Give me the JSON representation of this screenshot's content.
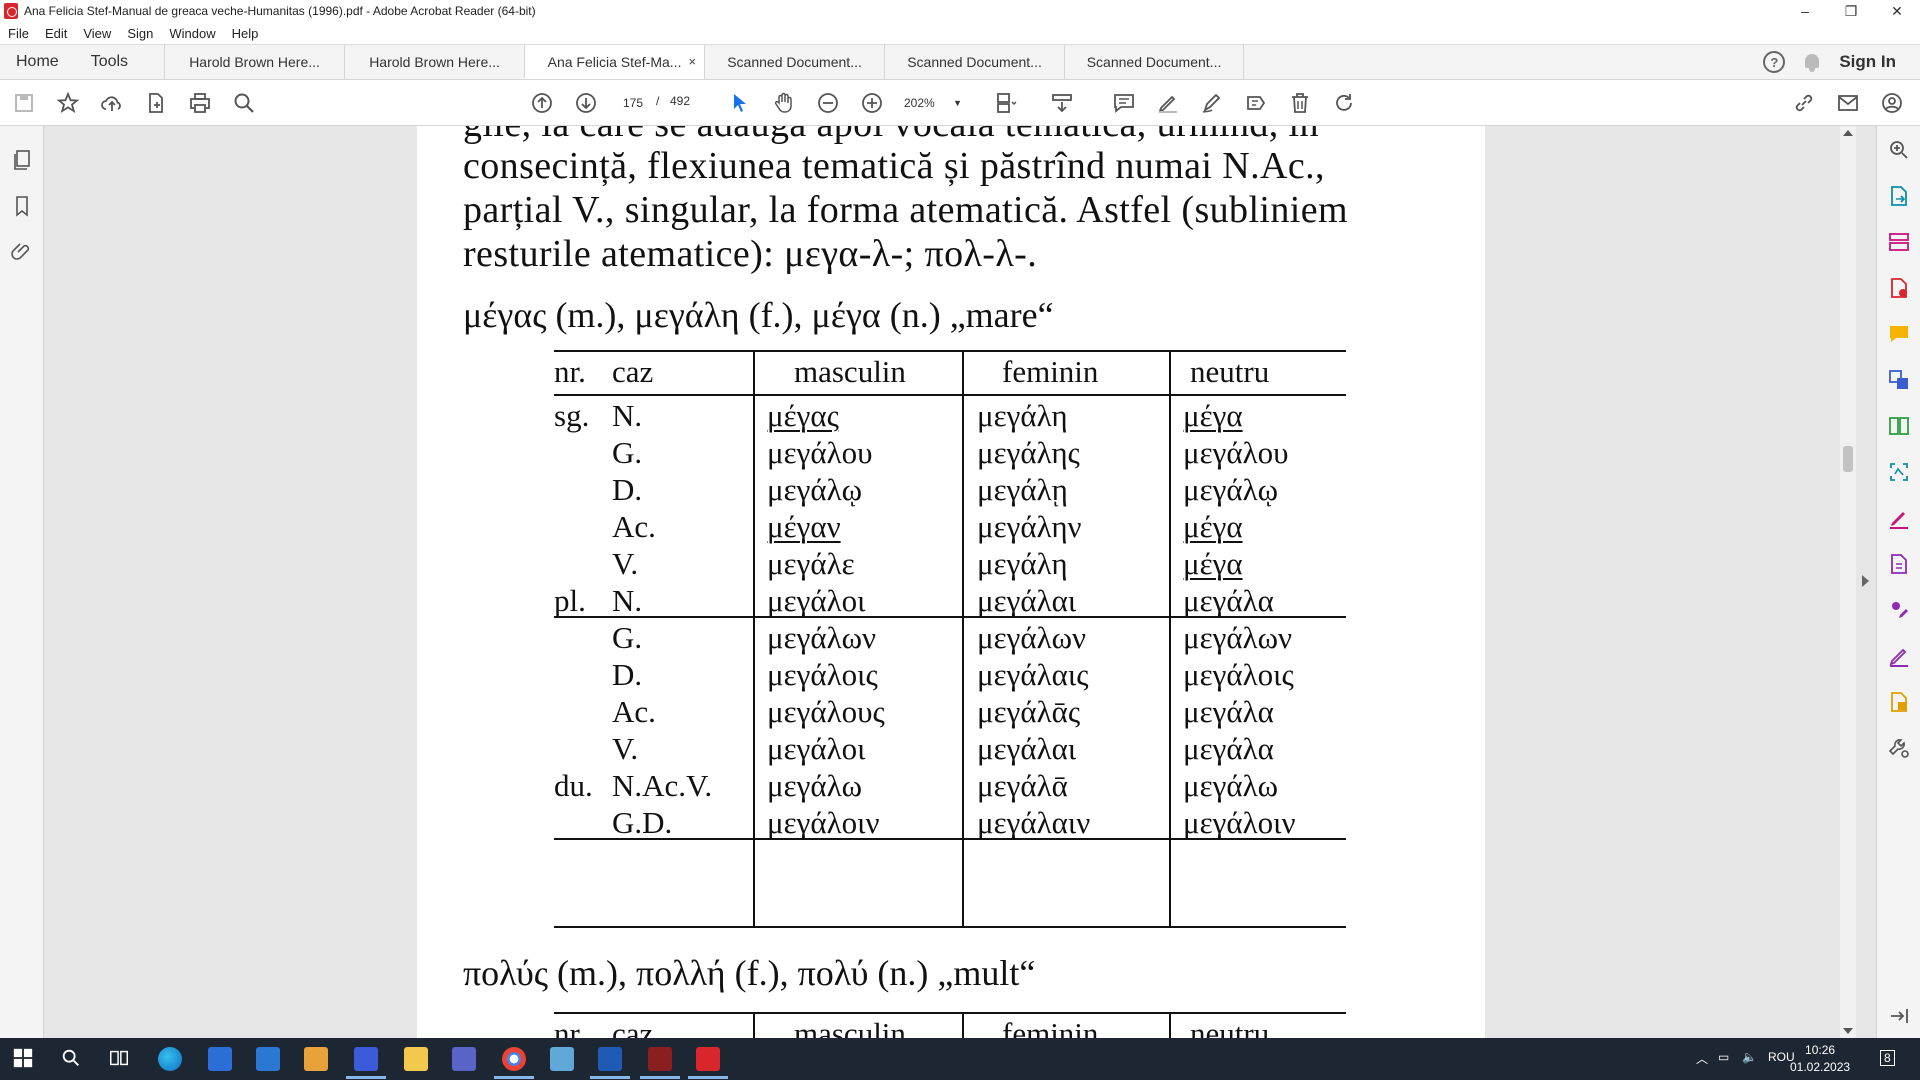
{
  "window": {
    "title": "Ana Felicia Stef-Manual de greaca veche-Humanitas (1996).pdf - Adobe Acrobat Reader (64-bit)",
    "minimize": "–",
    "maximize": "❐",
    "close": "✕"
  },
  "menu": [
    "File",
    "Edit",
    "View",
    "Sign",
    "Window",
    "Help"
  ],
  "tabs": {
    "home": "Home",
    "tools": "Tools",
    "documents": [
      {
        "label": "Harold Brown Here..."
      },
      {
        "label": "Harold Brown Here..."
      },
      {
        "label": "Ana Felicia Stef-Ma...",
        "close": "×"
      },
      {
        "label": "Scanned Document..."
      },
      {
        "label": "Scanned Document..."
      },
      {
        "label": "Scanned Document..."
      }
    ],
    "help": "?",
    "sign_in": "Sign In"
  },
  "toolbar": {
    "page_current": "175",
    "page_sep": "/",
    "page_total": "492",
    "zoom": "202%"
  },
  "document": {
    "intro_partial": "gile, la care se adaugă apoi vocala tematică, urmînd, în",
    "intro_line2": "consecință, flexiunea tematică și păstrînd numai N.Ac.,",
    "intro_line3": "parțial V., singular, la forma atematică. Astfel (subliniem",
    "intro_line4": "resturile atematice): μεγα-λ-; πολ-λ-.",
    "heading1": "μέγας (m.), μεγάλη (f.), μέγα (n.) „mare“",
    "table_headers": [
      "nr.",
      "caz",
      "masculin",
      "feminin",
      "neutru"
    ],
    "rows": [
      {
        "nr": "sg.",
        "caz": "N.",
        "m": "μέγας",
        "f": "μεγάλη",
        "n": "μέγα"
      },
      {
        "nr": "",
        "caz": "G.",
        "m": "μεγάλου",
        "f": "μεγάλης",
        "n": "μεγάλου"
      },
      {
        "nr": "",
        "caz": "D.",
        "m": "μεγάλῳ",
        "f": "μεγάλῃ",
        "n": "μεγάλῳ"
      },
      {
        "nr": "",
        "caz": "Ac.",
        "m": "μέγαν",
        "f": "μεγάλην",
        "n": "μέγα"
      },
      {
        "nr": "",
        "caz": "V.",
        "m": "μεγάλε",
        "f": "μεγάλη",
        "n": "μέγα"
      },
      {
        "nr": "pl.",
        "caz": "N.",
        "m": "μεγάλοι",
        "f": "μεγάλαι",
        "n": "μεγάλα"
      },
      {
        "nr": "",
        "caz": "G.",
        "m": "μεγάλων",
        "f": "μεγάλων",
        "n": "μεγάλων"
      },
      {
        "nr": "",
        "caz": "D.",
        "m": "μεγάλοις",
        "f": "μεγάλαις",
        "n": "μεγάλοις"
      },
      {
        "nr": "",
        "caz": "Ac.",
        "m": "μεγάλους",
        "f": "μεγάλᾱς",
        "n": "μεγάλα"
      },
      {
        "nr": "",
        "caz": "V.",
        "m": "μεγάλοι",
        "f": "μεγάλαι",
        "n": "μεγάλα"
      },
      {
        "nr": "du.",
        "caz": "N.Ac.V.",
        "m": "μεγάλω",
        "f": "μεγάλᾱ",
        "n": "μεγάλω"
      },
      {
        "nr": "",
        "caz": "G.D.",
        "m": "μεγάλοιν",
        "f": "μεγάλαιν",
        "n": "μεγάλοιν"
      }
    ],
    "heading2": "πολύς (m.), πολλή (f.), πολύ (n.) „mult“",
    "table2_headers": [
      "nr.",
      "caz",
      "masculin",
      "feminin",
      "neutru"
    ]
  },
  "taskbar": {
    "language": "ROU",
    "time": "10:26",
    "date": "01.02.2023",
    "notifications": "8"
  },
  "colors": {
    "acrobat_red": "#d9262c",
    "select_blue": "#1473e6",
    "taskbar": "#1d2633",
    "tool_pink": "#c8157e",
    "tool_teal": "#0d8ea8"
  }
}
